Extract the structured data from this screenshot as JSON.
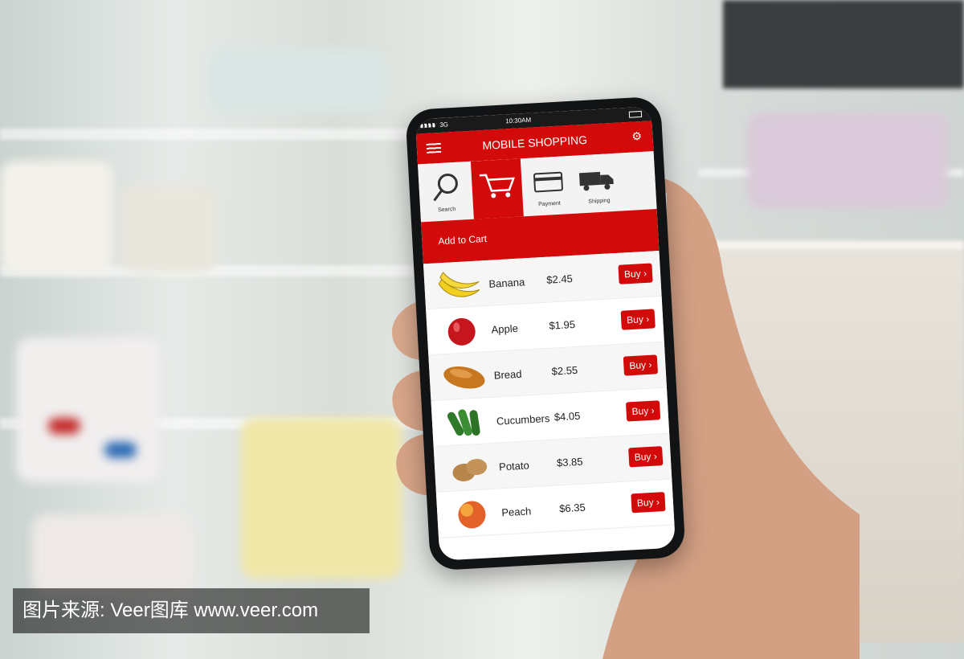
{
  "statusbar": {
    "network": "3G",
    "time": "10:30AM"
  },
  "app": {
    "title": "MOBILE SHOPPING"
  },
  "tabs": [
    {
      "label": "Search",
      "icon": "search-icon"
    },
    {
      "label": "",
      "icon": "cart-icon",
      "active": true
    },
    {
      "label": "Payment",
      "icon": "credit-card-icon"
    },
    {
      "label": "Shipping",
      "icon": "truck-icon"
    }
  ],
  "banner": {
    "text": "Add to Cart"
  },
  "products": [
    {
      "name": "Banana",
      "price": "$2.45",
      "buy": "Buy"
    },
    {
      "name": "Apple",
      "price": "$1.95",
      "buy": "Buy"
    },
    {
      "name": "Bread",
      "price": "$2.55",
      "buy": "Buy"
    },
    {
      "name": "Cucumbers",
      "price": "$4.05",
      "buy": "Buy"
    },
    {
      "name": "Potato",
      "price": "$3.85",
      "buy": "Buy"
    },
    {
      "name": "Peach",
      "price": "$6.35",
      "buy": "Buy"
    }
  ],
  "watermark": "图片来源: Veer图库 www.veer.com",
  "colors": {
    "brand_red": "#d20a0a"
  }
}
